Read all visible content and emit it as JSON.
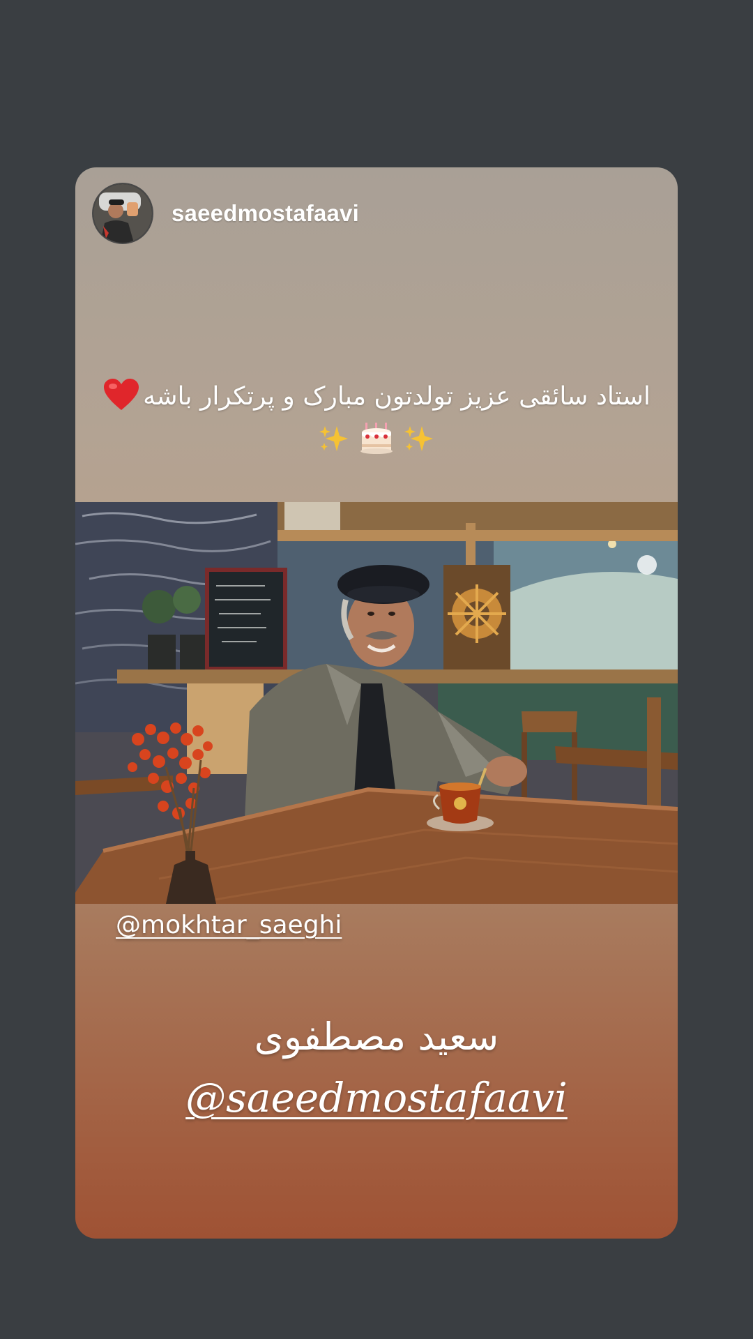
{
  "story": {
    "username": "saeedmostafaavi",
    "caption_line1": "استاد سائقی عزیز تولدتون مبارک و پرتکرار باشه",
    "caption_emoji": [
      "sparkles-icon",
      "birthday-cake-icon",
      "sparkles-icon"
    ],
    "photo_tag": "@mokhtar_saeghi",
    "name_fa": "سعید مصطفوی",
    "mention": "@saeedmostafaavi"
  },
  "colors": {
    "background": "#3a3e42",
    "card_top": "#a9a096",
    "card_bottom": "#9f5234",
    "text": "#ffffff",
    "heart": "#e0262b"
  }
}
